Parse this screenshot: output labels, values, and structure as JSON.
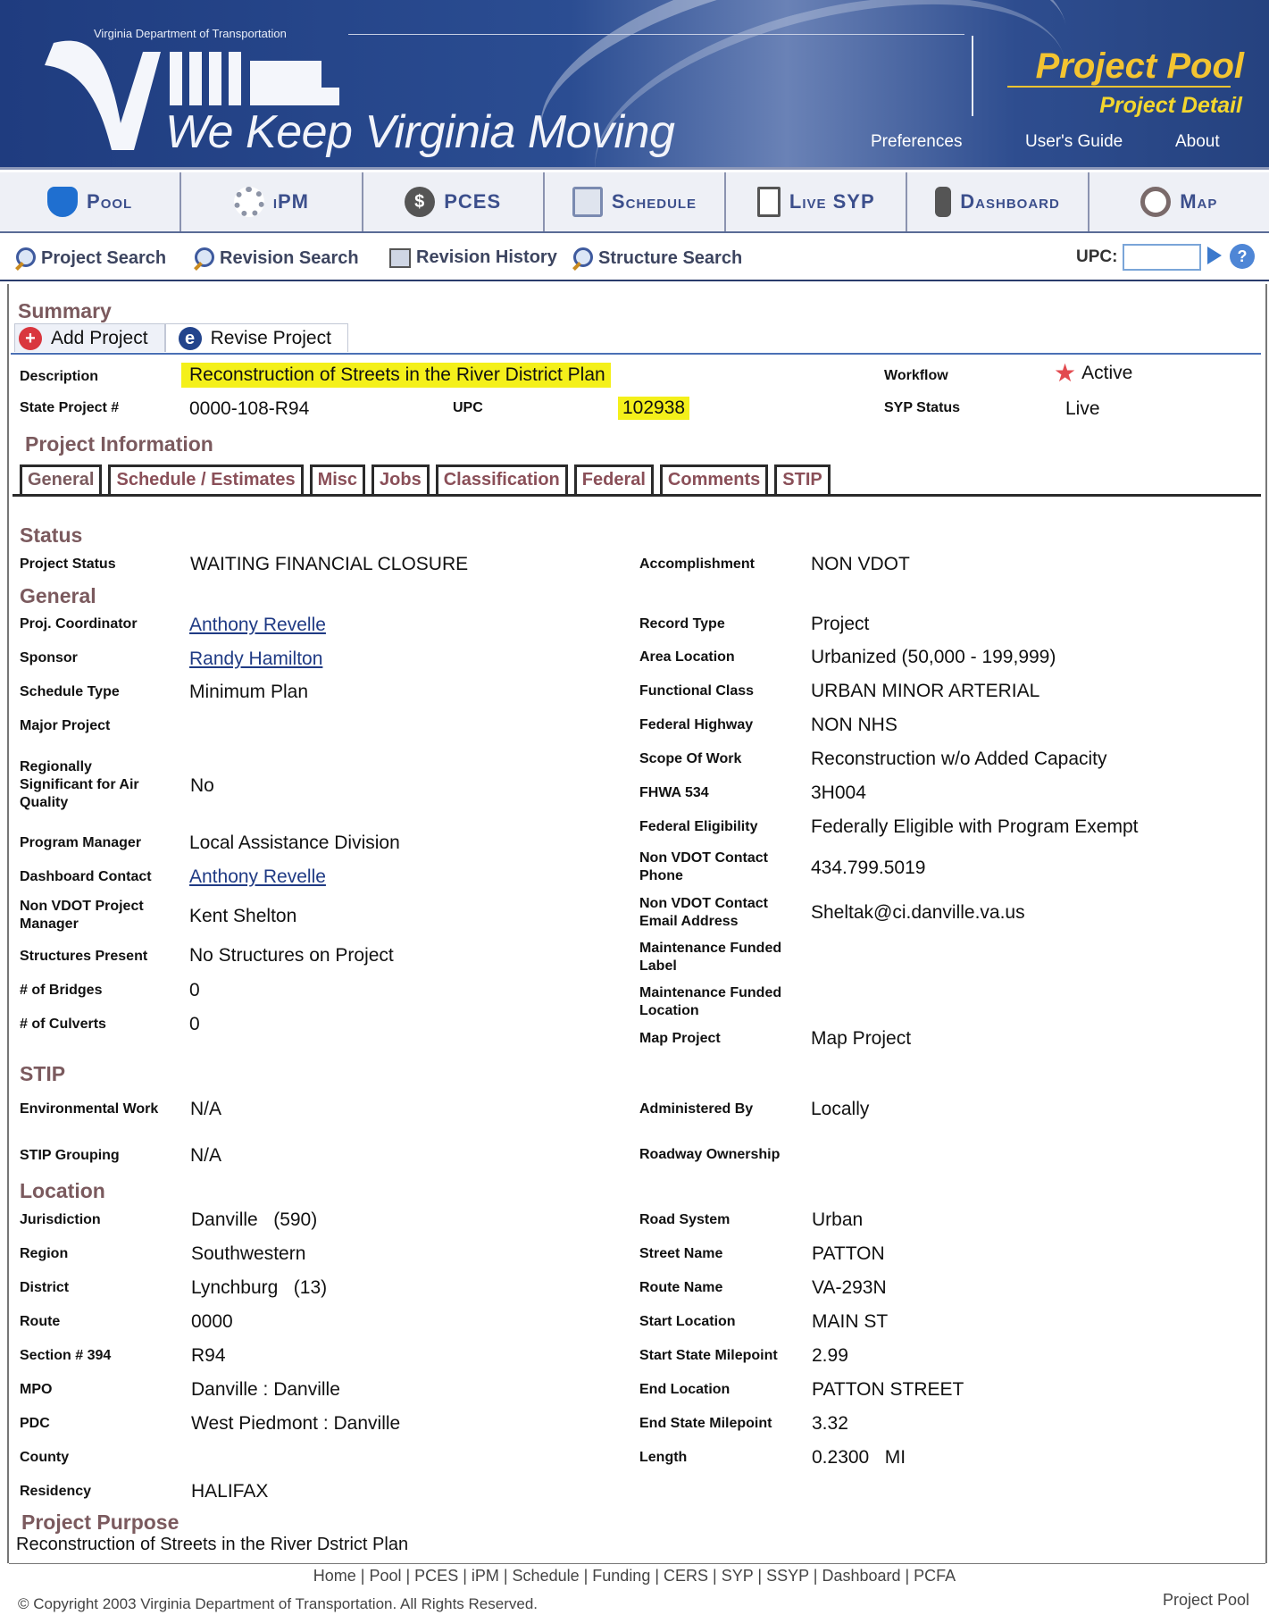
{
  "banner": {
    "department": "Virginia Department of Transportation",
    "logo_text": "VDOT",
    "tagline": "We Keep Virginia Moving",
    "app_title": "Project Pool",
    "app_subtitle": "Project Detail",
    "links": [
      "Preferences",
      "User's Guide",
      "About"
    ]
  },
  "modules": [
    {
      "label": "Pool",
      "icon": "pool-cylinder-icon",
      "color": "#1f6fd0"
    },
    {
      "label": "iPM",
      "icon": "gear-icon",
      "color": "#b7bdc9"
    },
    {
      "label": "PCES",
      "icon": "dollar-icon",
      "color": "#5b5b5b"
    },
    {
      "label": "Schedule",
      "icon": "schedule-calendar-icon",
      "color": "#8fa0c2"
    },
    {
      "label": "Live SYP",
      "icon": "document-icon",
      "color": "#c9d0de"
    },
    {
      "label": "Dashboard",
      "icon": "traffic-light-icon",
      "color": "#6b6b6b"
    },
    {
      "label": "Map",
      "icon": "compass-icon",
      "color": "#7a6a6a"
    }
  ],
  "search": {
    "links": [
      "Project Search",
      "Revision Search",
      "Revision History",
      "Structure Search"
    ],
    "upc_label": "UPC:",
    "upc_value": ""
  },
  "summary": {
    "heading": "Summary",
    "tabs": [
      "Add Project",
      "Revise Project"
    ],
    "description_label": "Description",
    "description": "Reconstruction of Streets in the River District Plan",
    "workflow_label": "Workflow",
    "workflow": "Active",
    "state_project_label": "State Project #",
    "state_project": "0000-108-R94",
    "upc_label": "UPC",
    "upc": "102938",
    "syp_status_label": "SYP Status",
    "syp_status": "Live"
  },
  "project_info": {
    "heading": "Project Information",
    "tabs": [
      "General",
      "Schedule / Estimates",
      "Misc",
      "Jobs",
      "Classification",
      "Federal",
      "Comments",
      "STIP"
    ]
  },
  "status": {
    "heading": "Status",
    "project_status_label": "Project Status",
    "project_status": "WAITING FINANCIAL CLOSURE",
    "accomplishment_label": "Accomplishment",
    "accomplishment": "NON VDOT"
  },
  "general": {
    "heading": "General",
    "left": [
      {
        "label": "Proj. Coordinator",
        "value": "Anthony Revelle",
        "link": true
      },
      {
        "label": "Sponsor",
        "value": "Randy Hamilton",
        "link": true
      },
      {
        "label": "Schedule Type",
        "value": "Minimum Plan"
      },
      {
        "label": "Major Project",
        "value": ""
      },
      {
        "label": "Regionally Significant for Air Quality",
        "value": "No"
      },
      {
        "label": "Program Manager",
        "value": "Local Assistance Division"
      },
      {
        "label": "Dashboard Contact",
        "value": "Anthony Revelle",
        "link": true
      },
      {
        "label": "Non VDOT Project Manager",
        "value": "Kent Shelton"
      },
      {
        "label": "Structures Present",
        "value": "No Structures on Project"
      },
      {
        "label": "# of Bridges",
        "value": "0"
      },
      {
        "label": "# of Culverts",
        "value": "0"
      }
    ],
    "right": [
      {
        "label": "Record Type",
        "value": "Project"
      },
      {
        "label": "Area Location",
        "value": "Urbanized (50,000 - 199,999)"
      },
      {
        "label": "Functional Class",
        "value": "URBAN MINOR ARTERIAL"
      },
      {
        "label": "Federal Highway",
        "value": "NON NHS"
      },
      {
        "label": "Scope Of Work",
        "value": "Reconstruction w/o Added Capacity"
      },
      {
        "label": "FHWA 534",
        "value": "3H004"
      },
      {
        "label": "Federal Eligibility",
        "value": "Federally Eligible with Program Exempt"
      },
      {
        "label": "Non VDOT Contact Phone",
        "value": "434.799.5019"
      },
      {
        "label": "Non VDOT Contact Email Address",
        "value": "Sheltak@ci.danville.va.us"
      },
      {
        "label": "Maintenance Funded Label",
        "value": ""
      },
      {
        "label": "Maintenance Funded Location",
        "value": ""
      },
      {
        "label": "Map Project",
        "value": "Map Project"
      }
    ]
  },
  "stip": {
    "heading": "STIP",
    "env_label": "Environmental Work",
    "env": "N/A",
    "admin_label": "Administered By",
    "admin": "Locally",
    "grouping_label": "STIP Grouping",
    "grouping": "N/A",
    "ownership_label": "Roadway Ownership",
    "ownership": ""
  },
  "location": {
    "heading": "Location",
    "left": [
      {
        "label": "Jurisdiction",
        "value": "Danville   (590)"
      },
      {
        "label": "Region",
        "value": "Southwestern"
      },
      {
        "label": "District",
        "value": "Lynchburg   (13)"
      },
      {
        "label": "Route",
        "value": "0000"
      },
      {
        "label": "Section # 394",
        "value": "R94"
      },
      {
        "label": "MPO",
        "value": "Danville : Danville"
      },
      {
        "label": "PDC",
        "value": "West Piedmont : Danville"
      },
      {
        "label": "County",
        "value": ""
      },
      {
        "label": "Residency",
        "value": "HALIFAX"
      }
    ],
    "right": [
      {
        "label": "Road System",
        "value": "Urban"
      },
      {
        "label": "Street Name",
        "value": "PATTON"
      },
      {
        "label": "Route Name",
        "value": "VA-293N"
      },
      {
        "label": "Start Location",
        "value": "MAIN ST"
      },
      {
        "label": "Start State Milepoint",
        "value": "2.99"
      },
      {
        "label": "End Location",
        "value": "PATTON STREET"
      },
      {
        "label": "End State Milepoint",
        "value": "3.32"
      },
      {
        "label": "Length",
        "value": "0.2300   MI"
      }
    ]
  },
  "purpose": {
    "heading": "Project Purpose",
    "text": "Reconstruction of Streets in the River Dstrict Plan"
  },
  "footer": {
    "links": "Home | Pool | PCES | iPM | Schedule | Funding | CERS | SYP | SSYP | Dashboard | PCFA",
    "copyright": "© Copyright 2003 Virginia Department of Transportation. All Rights Reserved.",
    "app": "Project Pool"
  }
}
